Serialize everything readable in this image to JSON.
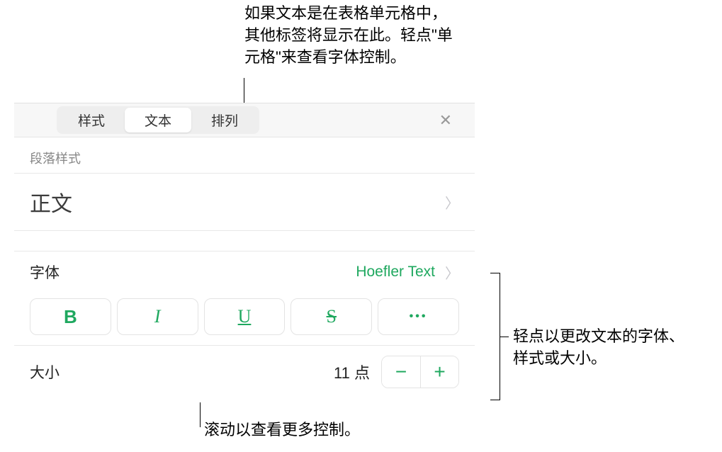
{
  "callouts": {
    "top": "如果文本是在表格单元格中，其他标签将显示在此。轻点\"单元格\"来查看字体控制。",
    "right_line1": "轻点以更改文本的字体、",
    "right_line2": "样式或大小。",
    "bottom": "滚动以查看更多控制。"
  },
  "tabs": {
    "style": "样式",
    "text": "文本",
    "arrange": "排列"
  },
  "paragraph": {
    "section_label": "段落样式",
    "style_name": "正文"
  },
  "font": {
    "label": "字体",
    "value": "Hoefler Text",
    "bold": "B",
    "italic": "I",
    "underline": "U",
    "strike": "S",
    "more": "•••"
  },
  "size": {
    "label": "大小",
    "value": "11 点",
    "minus": "−",
    "plus": "+"
  }
}
